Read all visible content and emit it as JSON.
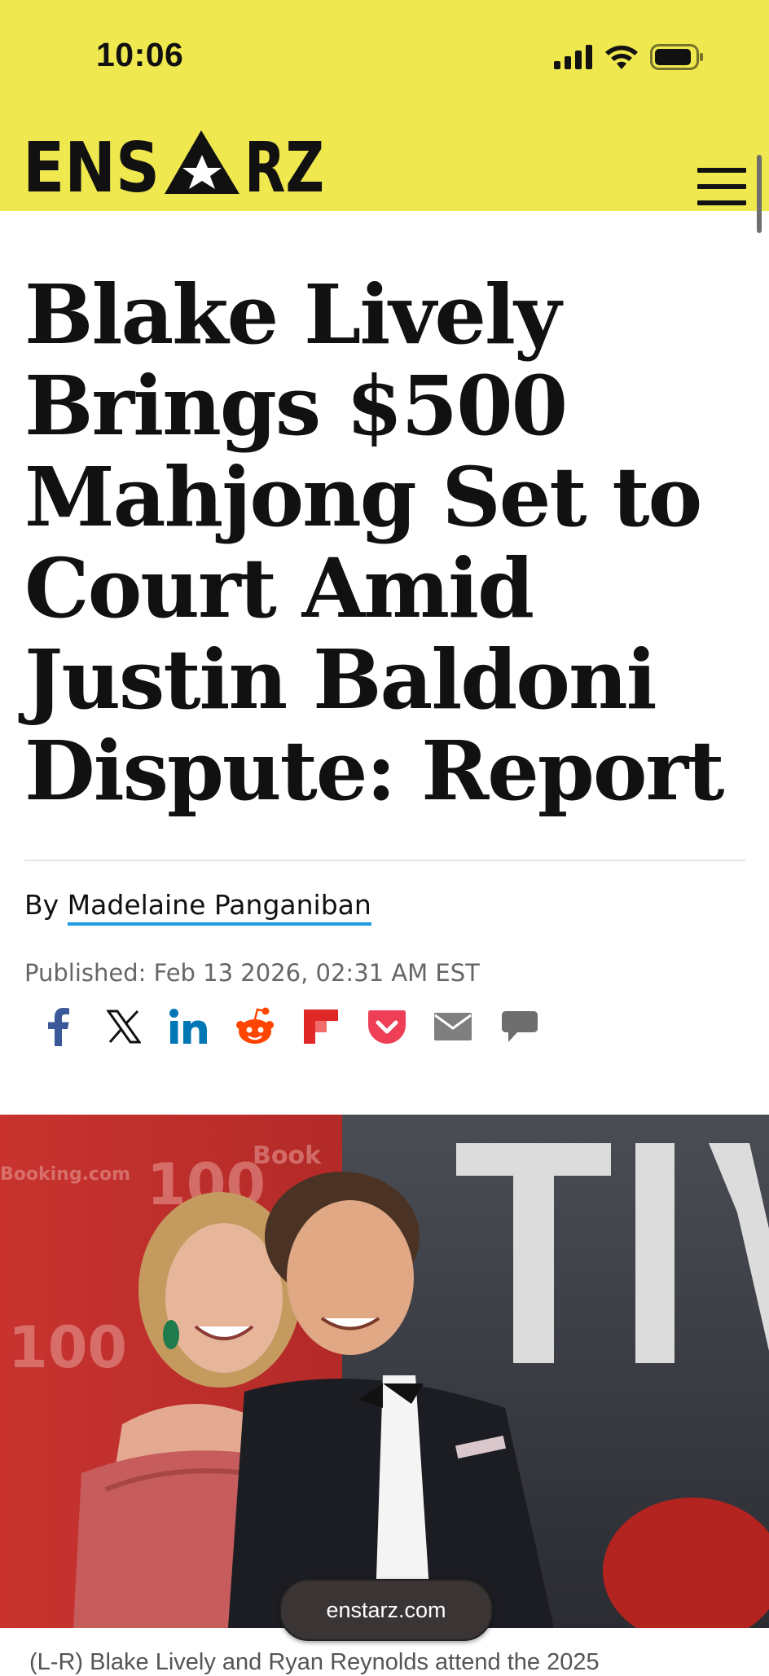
{
  "status_bar": {
    "time": "10:06",
    "icons": [
      "cellular-signal-icon",
      "wifi-icon",
      "battery-icon"
    ]
  },
  "header": {
    "logo_text": "ENSTARZ",
    "background_color": "#f0e84f",
    "menu_icon": "hamburger-menu-icon"
  },
  "article": {
    "headline_lines": [
      "Blake Lively",
      "Brings $500",
      "Mahjong Set to",
      "Court Amid",
      "Justin Baldoni",
      "Dispute: Report"
    ],
    "byline_prefix": "By",
    "author": "Madelaine Panganiban",
    "published": "Published: Feb 13 2026, 02:31 AM EST",
    "image_caption": "(L-R) Blake Lively and Ryan Reynolds attend the 2025"
  },
  "share": [
    {
      "name": "facebook",
      "icon": "facebook-icon",
      "color": "#3b5998"
    },
    {
      "name": "x",
      "icon": "x-icon",
      "color": "#111111"
    },
    {
      "name": "linkedin",
      "icon": "linkedin-icon",
      "color": "#0077b5"
    },
    {
      "name": "reddit",
      "icon": "reddit-icon",
      "color": "#ff4500"
    },
    {
      "name": "flipboard",
      "icon": "flipboard-icon",
      "color": "#e12828"
    },
    {
      "name": "pocket",
      "icon": "pocket-icon",
      "color": "#ef3f56"
    },
    {
      "name": "email",
      "icon": "email-icon",
      "color": "#7f7f7f"
    },
    {
      "name": "comments",
      "icon": "comment-icon",
      "color": "#6e6e6e"
    }
  ],
  "browser": {
    "url": "enstarz.com"
  },
  "colors": {
    "accent_underline": "#1e9be4"
  }
}
